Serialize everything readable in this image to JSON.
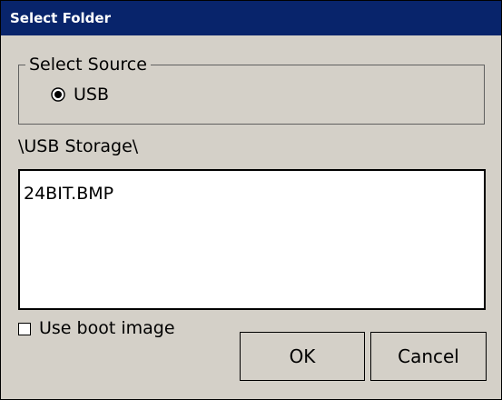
{
  "dialog": {
    "title": "Select Folder",
    "source_group": {
      "legend": "Select Source",
      "options": [
        {
          "label": "USB",
          "selected": true
        }
      ]
    },
    "current_path": "\\USB Storage\\",
    "files": [
      "24BIT.BMP"
    ],
    "boot_image_checkbox": {
      "label": "Use boot image",
      "checked": false
    },
    "buttons": {
      "ok_label": "OK",
      "cancel_label": "Cancel"
    }
  },
  "colors": {
    "titlebar": "#08246b",
    "title_text": "#ffffff",
    "dialog_background": "#d4d0c8",
    "list_background": "#ffffff"
  },
  "icons": {
    "radio": "radio-selected-icon",
    "checkbox": "checkbox-unchecked-icon"
  }
}
